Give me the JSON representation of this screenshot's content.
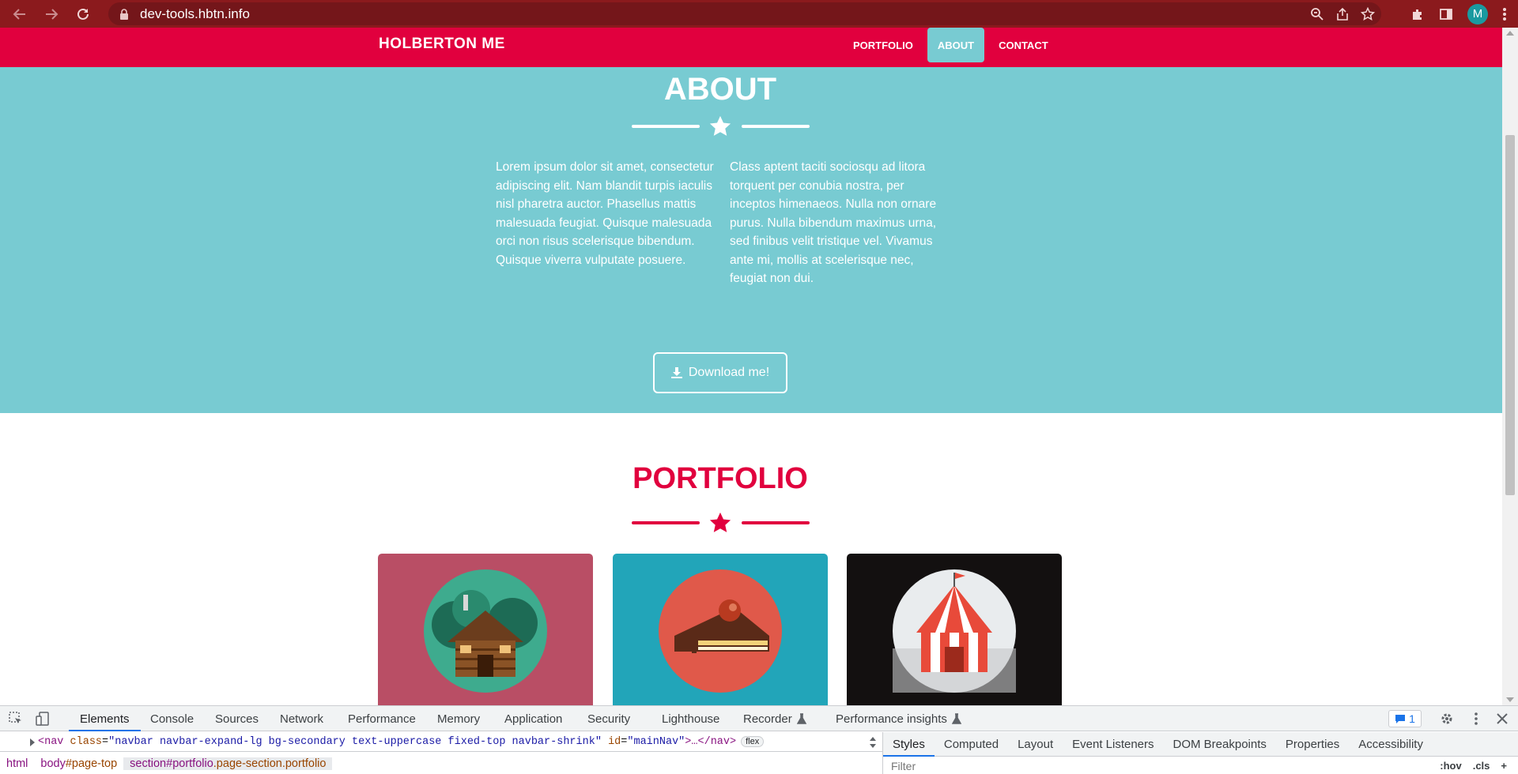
{
  "browser": {
    "url": "dev-tools.hbtn.info",
    "profile_initial": "M",
    "icons": [
      "back-icon",
      "forward-icon",
      "reload-icon",
      "lock-icon",
      "zoom-icon",
      "share-icon",
      "bookmark-star-icon",
      "extensions-icon",
      "side-panel-icon",
      "menu-dots-icon"
    ]
  },
  "site": {
    "brand": "HOLBERTON ME",
    "nav": [
      {
        "label": "PORTFOLIO",
        "active": false
      },
      {
        "label": "ABOUT",
        "active": true
      },
      {
        "label": "CONTACT",
        "active": false
      }
    ],
    "about": {
      "title": "ABOUT",
      "col1": "Lorem ipsum dolor sit amet, consectetur adipiscing elit. Nam blandit turpis iaculis nisl pharetra auctor. Phasellus mattis malesuada feugiat. Quisque malesuada orci non risus scelerisque bibendum. Quisque viverra vulputate posuere.",
      "col2": "Class aptent taciti sociosqu ad litora torquent per conubia nostra, per inceptos himenaeos. Nulla non ornare purus. Nulla bibendum maximus urna, sed finibus velit tristique vel. Vivamus ante mi, mollis at scelerisque nec, feugiat non dui.",
      "download_label": "Download me!"
    },
    "portfolio": {
      "title": "PORTFOLIO",
      "items": [
        "cabin-image",
        "cake-image",
        "circus-tent-image"
      ]
    },
    "colors": {
      "primary": "#e1003e",
      "secondary": "#78cbd2",
      "chrome": "#8b1a1d"
    }
  },
  "devtools": {
    "tabs": [
      "Elements",
      "Console",
      "Sources",
      "Network",
      "Performance",
      "Memory",
      "Application",
      "Security",
      "Lighthouse",
      "Recorder",
      "Performance insights"
    ],
    "active_tab": "Elements",
    "issues_count": "1",
    "source_line": {
      "tag_open": "<nav",
      "class_attr": "class",
      "class_val": "\"navbar navbar-expand-lg bg-secondary text-uppercase fixed-top navbar-shrink\"",
      "id_attr": "id",
      "id_val": "\"mainNav\"",
      "rest": ">…</nav>",
      "badge": "flex"
    },
    "breadcrumb": [
      {
        "tag": "html",
        "id": "",
        "cls": ""
      },
      {
        "tag": "body",
        "id": "#page-top",
        "cls": ""
      },
      {
        "tag": "section",
        "id": "#portfolio",
        "cls": ".page-section.portfolio"
      }
    ],
    "side_tabs": [
      "Styles",
      "Computed",
      "Layout",
      "Event Listeners",
      "DOM Breakpoints",
      "Properties",
      "Accessibility"
    ],
    "active_side_tab": "Styles",
    "filter_placeholder": "Filter",
    "filter_tools": [
      ":hov",
      ".cls",
      "+"
    ]
  }
}
